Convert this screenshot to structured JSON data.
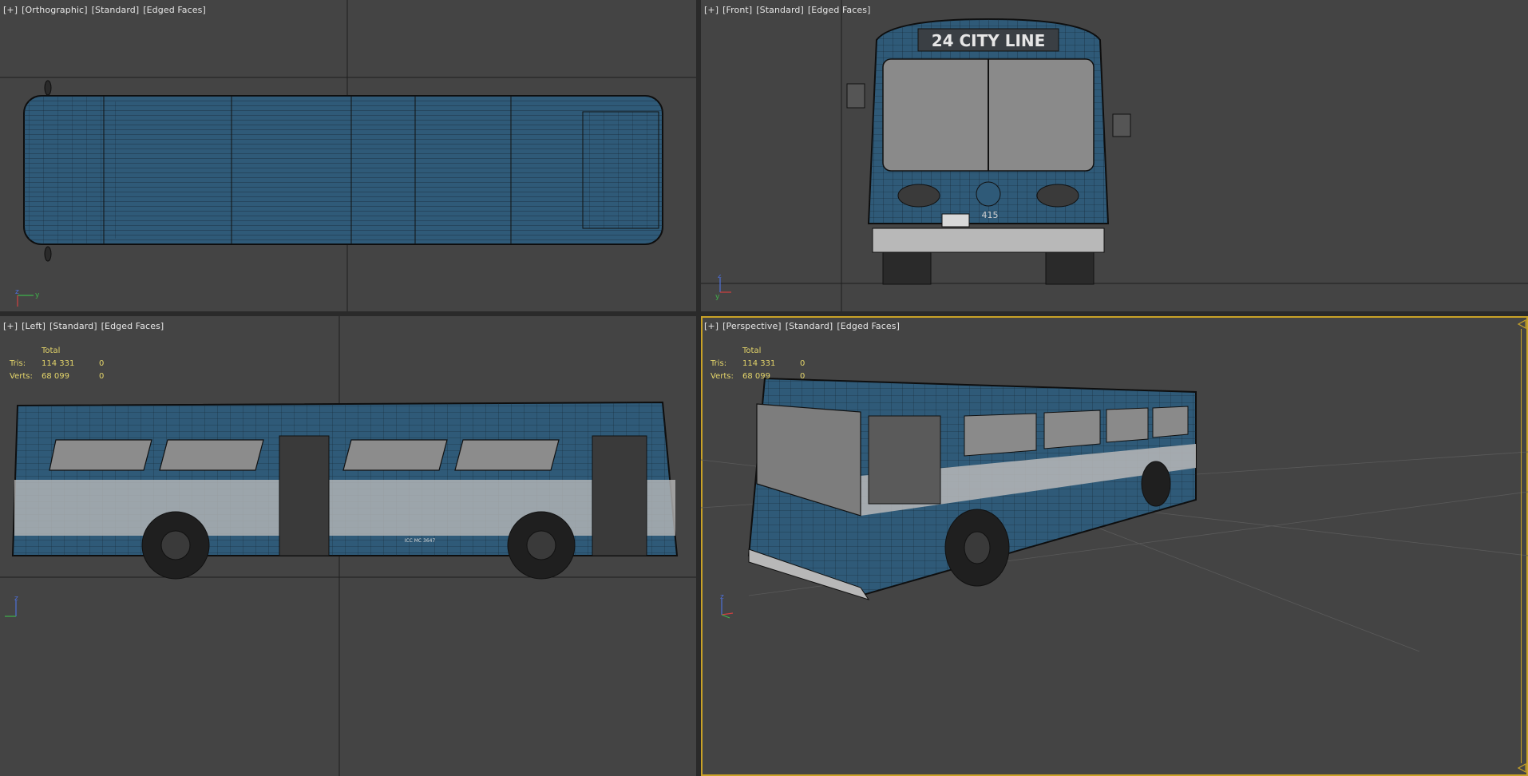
{
  "viewports": {
    "top": {
      "plus": "[+]",
      "view": "[Orthographic]",
      "shading": "[Standard]",
      "faces": "[Edged Faces]"
    },
    "front": {
      "plus": "[+]",
      "view": "[Front]",
      "shading": "[Standard]",
      "faces": "[Edged Faces]"
    },
    "left": {
      "plus": "[+]",
      "view": "[Left]",
      "shading": "[Standard]",
      "faces": "[Edged Faces]"
    },
    "perspective": {
      "plus": "[+]",
      "view": "[Perspective]",
      "shading": "[Standard]",
      "faces": "[Edged Faces]"
    }
  },
  "stats": {
    "header": "Total",
    "tris_label": "Tris:",
    "tris_total": "114 331",
    "tris_sel": "0",
    "verts_label": "Verts:",
    "verts_total": "68 099",
    "verts_sel": "0"
  },
  "bus": {
    "destination_sign": "24 CITY LINE",
    "fleet_number": "415",
    "plate_text": "ICC MC 3647"
  },
  "colors": {
    "viewport_bg": "#444444",
    "active_border": "#c9a227",
    "bus_blue": "#2f5a78",
    "stripe": "#b8b8b8",
    "stats_text": "#e4d56a"
  }
}
